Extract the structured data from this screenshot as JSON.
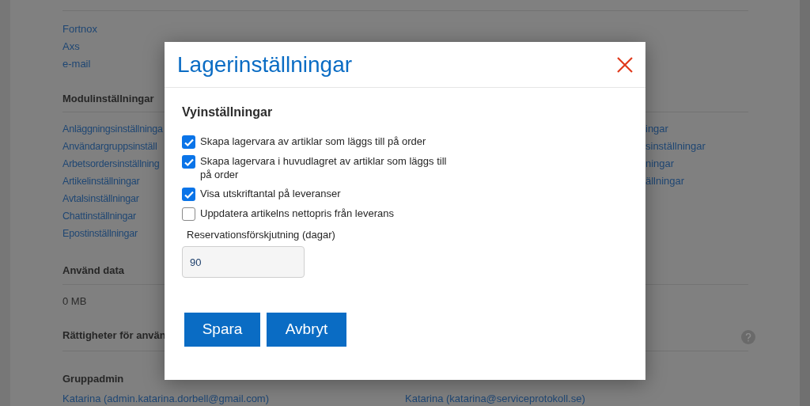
{
  "integrations": {
    "links": [
      "Fortnox",
      "Axs",
      "e-mail"
    ]
  },
  "module_settings": {
    "heading": "Modulinställningar",
    "left_links": [
      "Anläggningsinställninga",
      "Användargruppsinställ",
      "Arbetsordersinställning",
      "Artikelinställningar",
      "Avtalsinställningar",
      "Chattinställningar",
      "Epostinställningar"
    ],
    "right_links": [
      "ingar",
      "sinställningar",
      "ningar",
      "ällningar"
    ]
  },
  "used_data": {
    "heading": "Använd data",
    "value": "0 MB"
  },
  "permissions": {
    "heading": "Rättigheter för använ"
  },
  "group_admin": {
    "heading": "Gruppadmin",
    "admins": [
      "Katarina (admin.katarina.dorbell@gmail.com)",
      "Katarina (katarina@serviceprotokoll.se)"
    ]
  },
  "dialog": {
    "title": "Lagerinställningar",
    "section_title": "Vyinställningar",
    "options": [
      {
        "label": "Skapa lagervara av artiklar som läggs till på order",
        "checked": true
      },
      {
        "label": "Skapa lagervara i huvudlagret av artiklar som läggs till på order",
        "checked": true
      },
      {
        "label": "Visa utskriftantal på leveranser",
        "checked": true
      },
      {
        "label": "Uppdatera artikelns nettopris från leverans",
        "checked": false
      }
    ],
    "field": {
      "label": "Reservationsförskjutning (dagar)",
      "value": "90"
    },
    "buttons": [
      "Spara",
      "Avbryt"
    ]
  }
}
